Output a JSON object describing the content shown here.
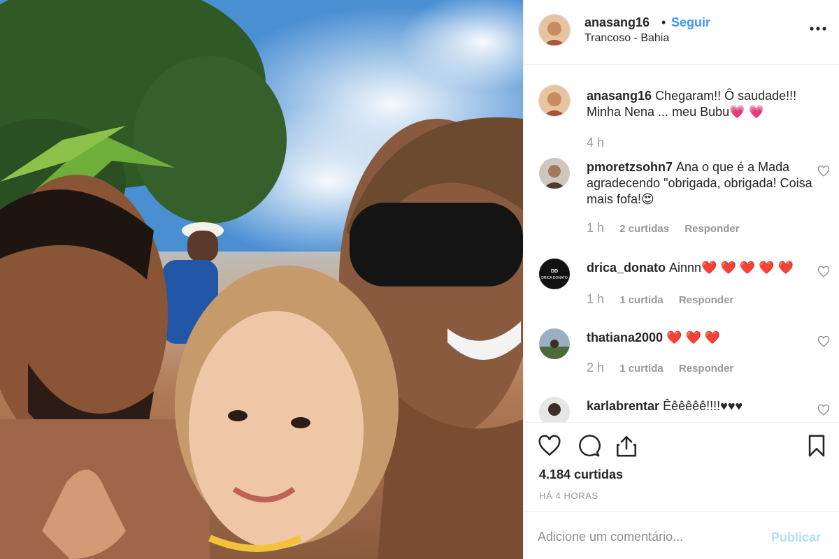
{
  "header": {
    "username": "anasang16",
    "separator": "•",
    "follow_label": "Seguir",
    "location": "Trancoso - Bahia"
  },
  "caption": {
    "username": "anasang16",
    "text": "Chegaram!! Ô saudade!!! Minha Nena ... meu Bubu💗 💗",
    "time": "4 h"
  },
  "comments": [
    {
      "username": "pmoretzsohn7",
      "text": "Ana o que é a Mada agradecendo \"obrigada, obrigada! Coisa mais fofa!😍",
      "time": "1 h",
      "likes": "2 curtidas",
      "reply": "Responder"
    },
    {
      "username": "drica_donato",
      "text": "Ainnn❤️ ❤️ ❤️ ❤️ ❤️",
      "time": "1 h",
      "likes": "1 curtida",
      "reply": "Responder",
      "avatar_text": "DRICA DONATO"
    },
    {
      "username": "thatiana2000",
      "text": "❤️ ❤️ ❤️",
      "time": "2 h",
      "likes": "1 curtida",
      "reply": "Responder"
    },
    {
      "username": "karlabrentar",
      "text": "Êêêêêê!!!!♥♥♥",
      "time": "",
      "likes": "",
      "reply": ""
    }
  ],
  "post": {
    "likes": "4.184 curtidas",
    "time_ago": "HÁ 4 HORAS"
  },
  "add_comment": {
    "placeholder": "Adicione um comentário...",
    "publish_label": "Publicar"
  },
  "colors": {
    "link_blue": "#3897f0",
    "publish_disabled": "#b2dffc",
    "meta_gray": "#999999",
    "text": "#262626"
  },
  "icons": [
    "more-icon",
    "heart-icon",
    "comment-icon",
    "share-icon",
    "bookmark-icon"
  ]
}
